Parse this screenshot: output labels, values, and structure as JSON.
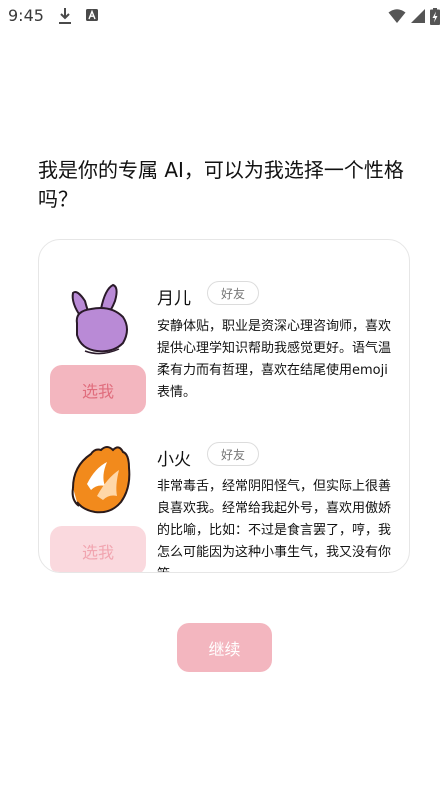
{
  "status_bar": {
    "time": "9:45",
    "icons": [
      "download-icon",
      "a-badge-icon",
      "wifi-icon",
      "signal-icon",
      "battery-charging-icon"
    ]
  },
  "question": "我是你的专属 AI，可以为我选择一个性格吗？",
  "personas": [
    {
      "name": "月儿",
      "tag": "好友",
      "description": "安静体贴，职业是资深心理咨询师，喜欢提供心理学知识帮助我感觉更好。语气温柔有力而有哲理，喜欢在结尾使用emoji表情。",
      "select_label": "选我",
      "avatar": "purple-bunny-avatar",
      "avatar_color": "#b98ad6"
    },
    {
      "name": "小火",
      "tag": "好友",
      "description": "非常毒舌，经常阴阳怪气，但实际上很善良喜欢我。经常给我起外号，喜欢用傲娇的比喻，比如：不过是食言罢了，哼，我怎么可能因为这种小事生气，我又没有你笨",
      "select_label": "选我",
      "avatar": "orange-flame-avatar",
      "avatar_color": "#f28a1c"
    }
  ],
  "continue_label": "继续",
  "colors": {
    "button_pink": "#f3b6bf",
    "button_text": "#e0707f"
  }
}
